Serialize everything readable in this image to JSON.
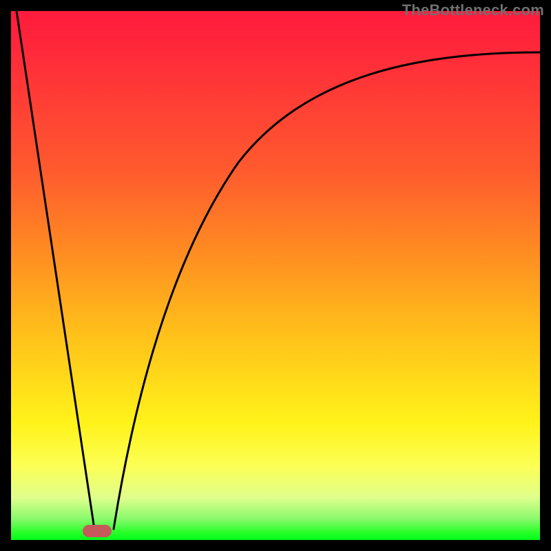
{
  "watermark": "TheBottleneck.com",
  "colors": {
    "curve": "#000000",
    "marker": "#c65a5a",
    "frame": "#000000"
  },
  "chart_data": {
    "type": "line",
    "title": "",
    "xlabel": "",
    "ylabel": "",
    "xlim": [
      0,
      100
    ],
    "ylim": [
      0,
      100
    ],
    "grid": false,
    "legend": false,
    "annotations": [],
    "series": [
      {
        "name": "left-slope",
        "x": [
          0,
          15.5
        ],
        "values": [
          100,
          2
        ]
      },
      {
        "name": "right-curve",
        "x": [
          19,
          22,
          26,
          30,
          35,
          40,
          46,
          53,
          60,
          68,
          76,
          84,
          92,
          100
        ],
        "values": [
          2,
          18,
          35,
          48,
          58,
          66,
          72,
          77,
          81,
          84.5,
          87,
          89,
          90.5,
          91.5
        ]
      }
    ],
    "marker": {
      "x_range": [
        13.8,
        19.3
      ],
      "y": 1.3
    }
  }
}
